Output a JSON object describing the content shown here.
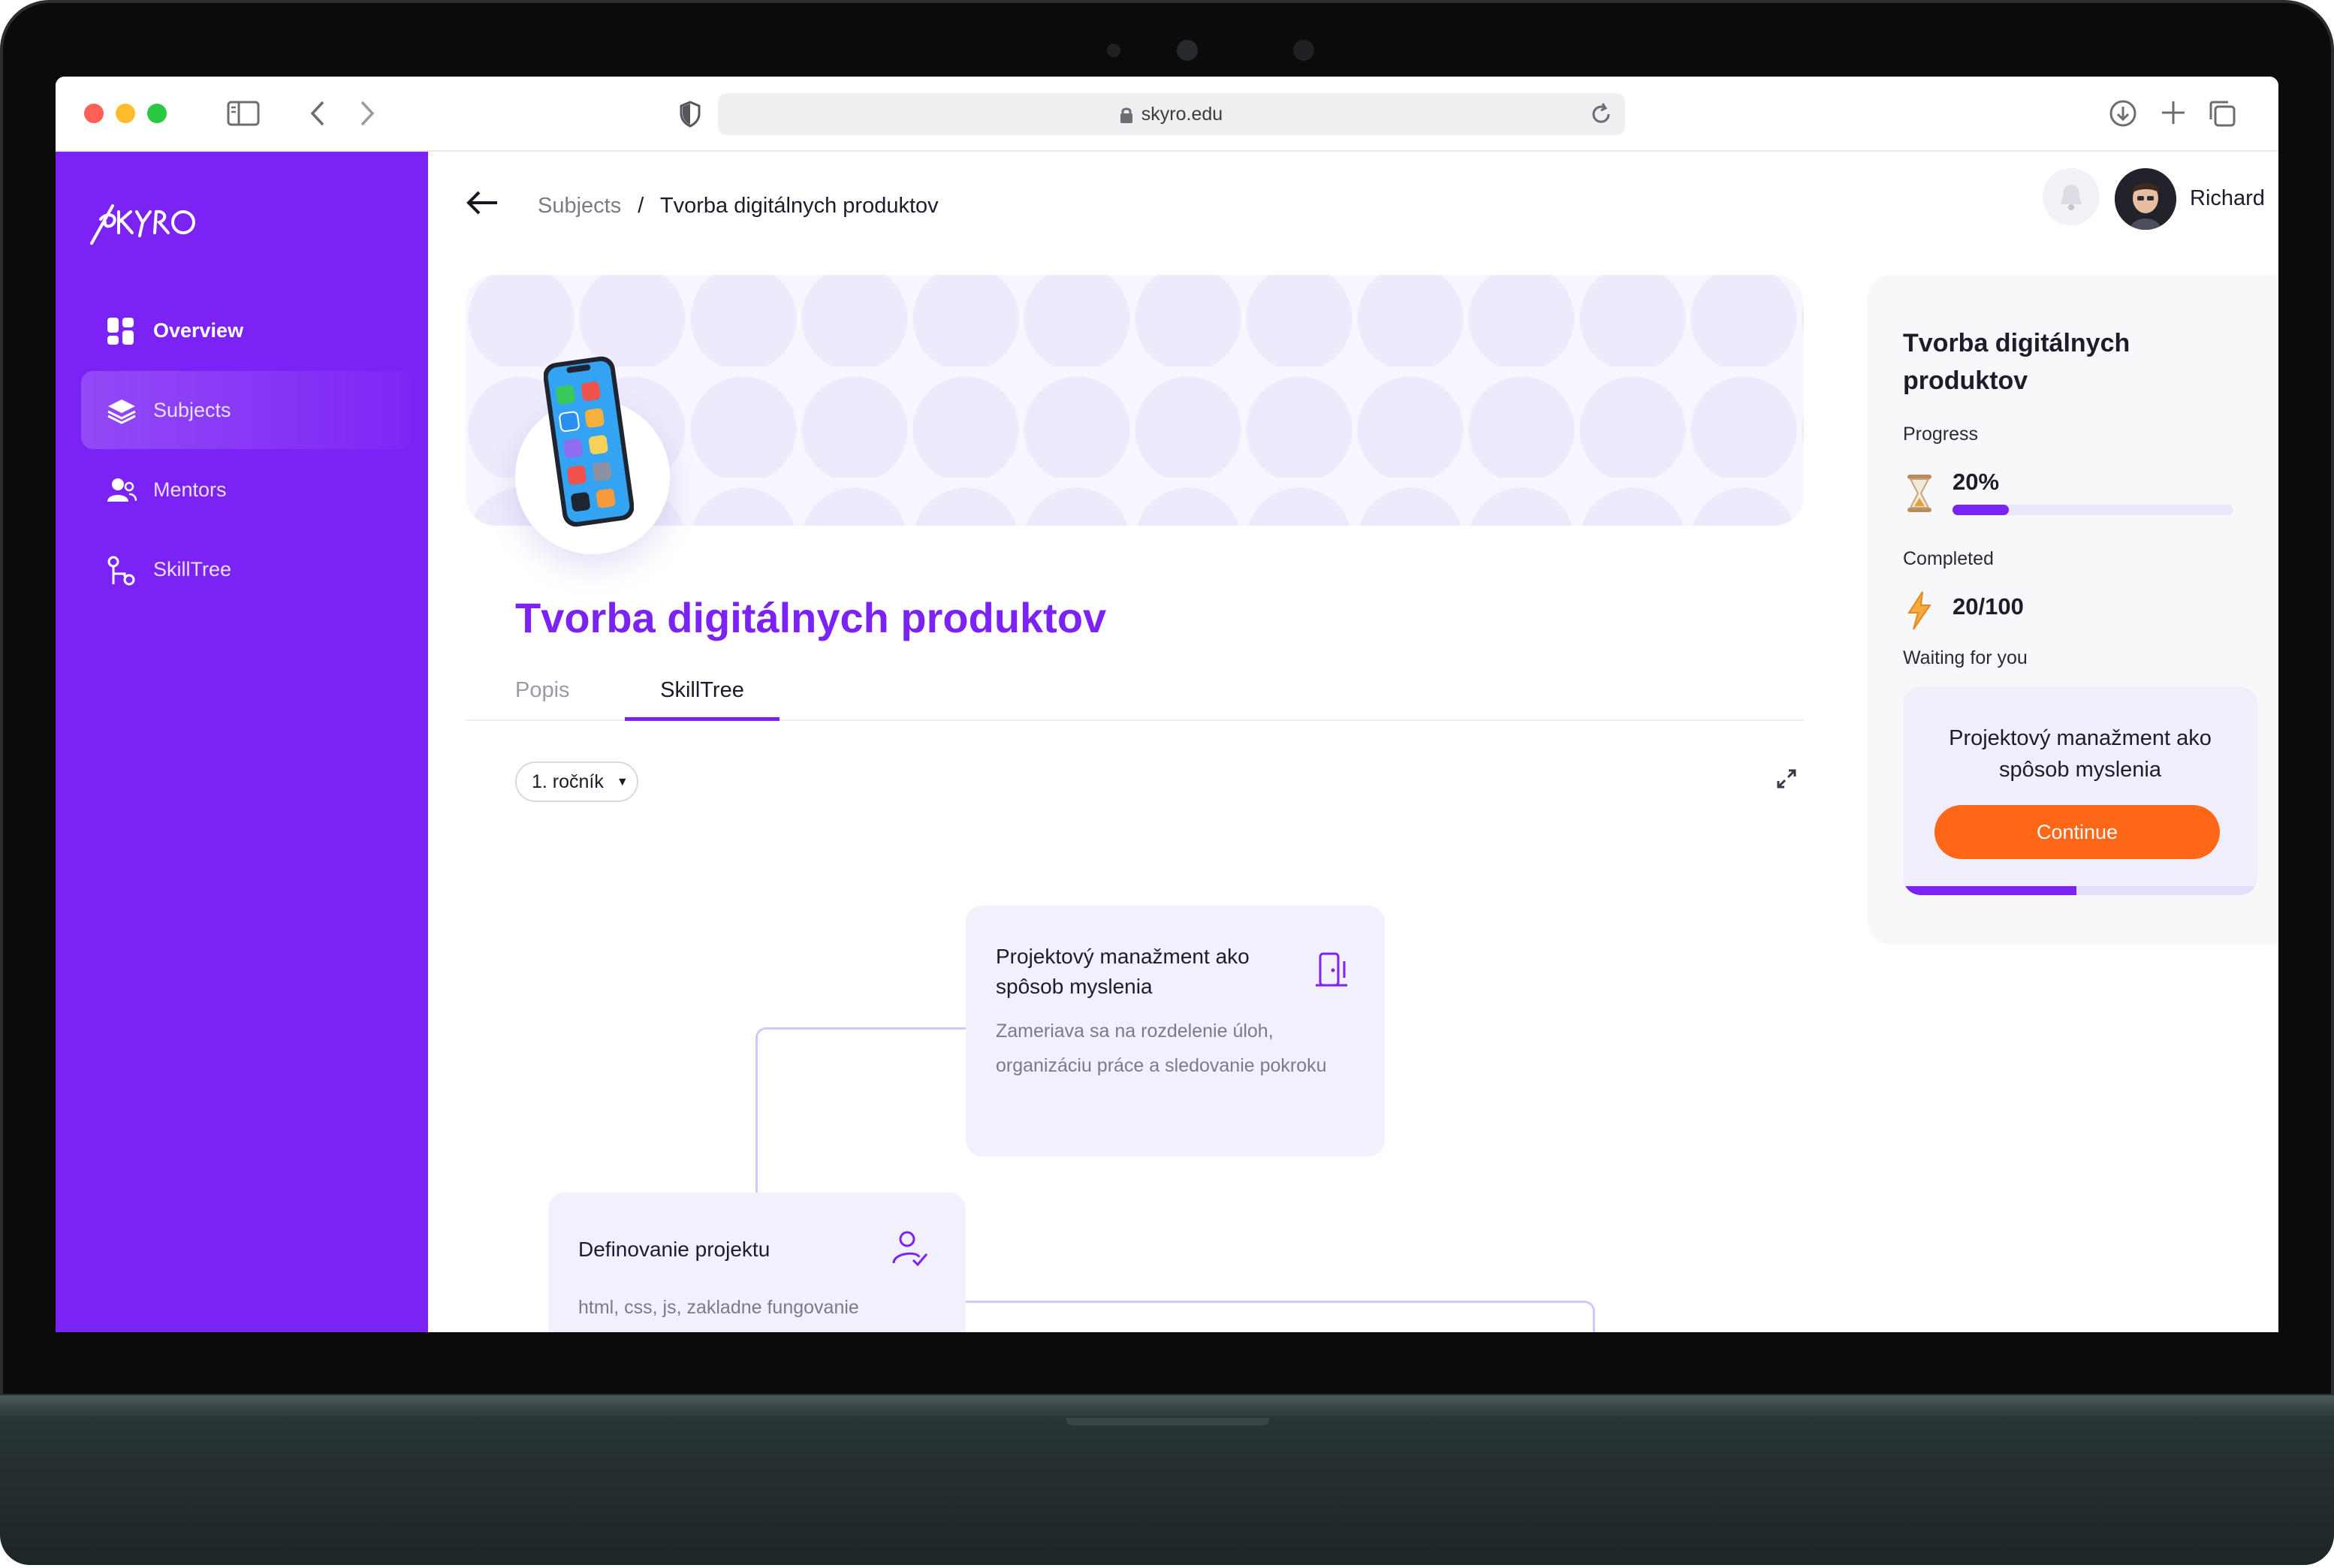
{
  "browser": {
    "url": "skyro.edu"
  },
  "sidebar": {
    "logo": "SKYRO",
    "items": [
      {
        "label": "Overview",
        "icon": "overview-grid-icon"
      },
      {
        "label": "Subjects",
        "icon": "stack-icon",
        "active": true
      },
      {
        "label": "Mentors",
        "icon": "users-icon"
      },
      {
        "label": "SkillTree",
        "icon": "skilltree-icon"
      }
    ]
  },
  "header": {
    "breadcrumb_parent": "Subjects",
    "breadcrumb_separator": "/",
    "breadcrumb_current": "Tvorba digitálnych produktov",
    "user_name": "Richard"
  },
  "subject": {
    "title": "Tvorba digitálnych produktov",
    "tabs": [
      {
        "label": "Popis",
        "active": false
      },
      {
        "label": "SkillTree",
        "active": true
      }
    ],
    "year_select": "1. ročník"
  },
  "skilltree": {
    "nodes": [
      {
        "title": "Projektový manažment ako spôsob myslenia",
        "description": "Zameriava sa na rozdelenie úloh, organizáciu práce a sledovanie pokroku",
        "icon": "door-icon"
      },
      {
        "title": "Definovanie projektu",
        "description": "html, css,  js, zakladne fungovanie webstranok (ze su to nejake subory co sa od niekl nacitaju, atd.)",
        "icon": "user-check-icon"
      }
    ]
  },
  "panel": {
    "title": "Tvorba digitálnych produktov",
    "progress_label": "Progress",
    "progress_value": "20%",
    "progress_fraction": 0.2,
    "completed_label": "Completed",
    "completed_value": "20/100",
    "waiting_label": "Waiting for you",
    "waiting_item": "Projektový manažment ako spôsob myslenia",
    "continue_label": "Continue",
    "waiting_progress_fraction": 0.49
  },
  "colors": {
    "brand": "#7b22f5",
    "accent": "#ff6718"
  }
}
